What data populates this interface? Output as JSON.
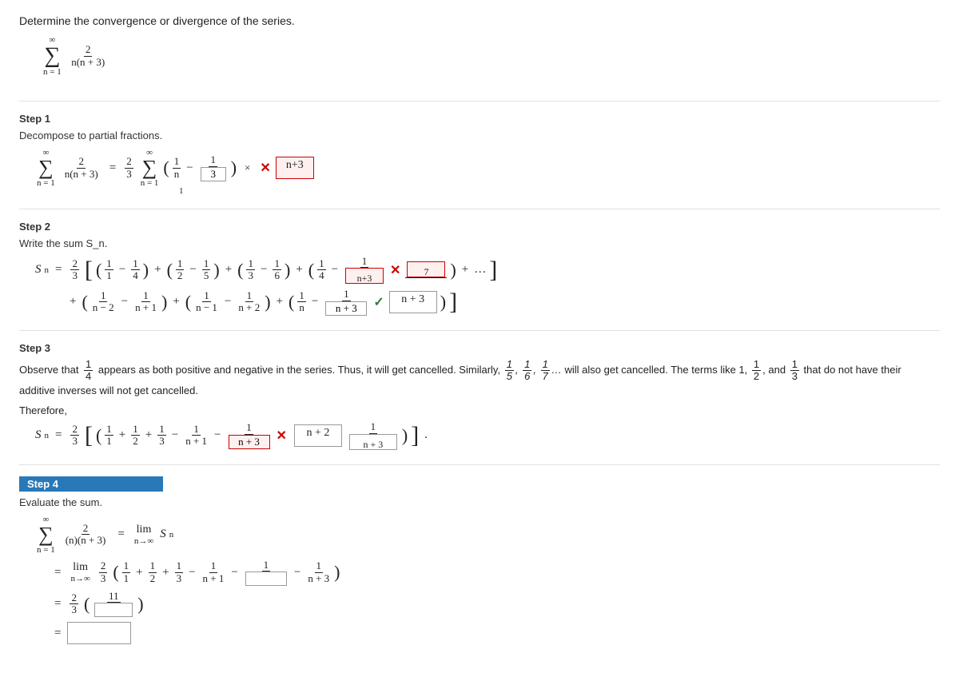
{
  "problem": {
    "title": "Determine the convergence or divergence of the series.",
    "series_top": "∞",
    "series_bot": "n = 1",
    "series_num": "2",
    "series_den": "n(n + 3)"
  },
  "step1": {
    "label": "Step 1",
    "description": "Decompose to partial fractions.",
    "input_value": "3",
    "wrong_value": "n+3"
  },
  "step2": {
    "label": "Step 2",
    "description": "Write the sum S_n.",
    "wrong_value1": "n+3",
    "wrong_value2": "7",
    "correct_value": "n+3"
  },
  "step3": {
    "label": "Step 3",
    "text1": "Observe that",
    "frac1": {
      "num": "1",
      "den": "4"
    },
    "text2": "appears as both positive and negative in the series. Thus, it will get cancelled. Similarly,",
    "fracs_cancel": "1/5, 1/6, 1/7,...",
    "text3": "will also get cancelled. The terms like",
    "terms_keep": "1, 1/2,",
    "text4": "and",
    "frac_and": {
      "num": "1",
      "den": "3"
    },
    "text5": "that do not have their additive inverses will not get cancelled.",
    "therefore": "Therefore,"
  },
  "step4": {
    "label": "Step 4",
    "description": "Evaluate the sum.",
    "series_top": "∞",
    "series_bot": "n = 1",
    "series_num": "2",
    "series_den": "(n)(n + 3)",
    "input1": "11",
    "input2": ""
  },
  "icons": {
    "cross": "✕",
    "check": "✓"
  }
}
